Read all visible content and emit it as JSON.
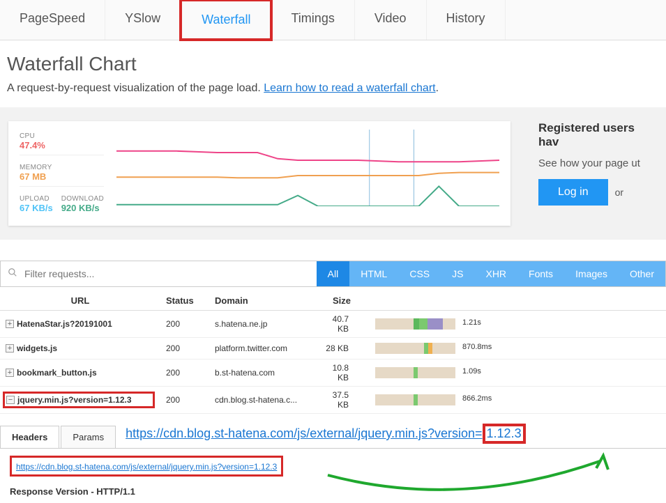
{
  "tabs": [
    "PageSpeed",
    "YSlow",
    "Waterfall",
    "Timings",
    "Video",
    "History"
  ],
  "active_tab": "Waterfall",
  "page_title": "Waterfall Chart",
  "subtitle_prefix": "A request-by-request visualization of the page load. ",
  "subtitle_link": "Learn how to read a waterfall chart",
  "subtitle_suffix": ".",
  "metrics": {
    "cpu_label": "CPU",
    "cpu_value": "47.4%",
    "memory_label": "MEMORY",
    "memory_value": "67 MB",
    "upload_label": "UPLOAD",
    "upload_value": "67 KB/s",
    "download_label": "DOWNLOAD",
    "download_value": "920 KB/s"
  },
  "side": {
    "title": "Registered users hav",
    "text": "See how your page ut",
    "login": "Log in",
    "or": "or"
  },
  "filter": {
    "placeholder": "Filter requests...",
    "tabs": [
      "All",
      "HTML",
      "CSS",
      "JS",
      "XHR",
      "Fonts",
      "Images",
      "Other"
    ],
    "active": "All"
  },
  "columns": {
    "url": "URL",
    "status": "Status",
    "domain": "Domain",
    "size": "Size"
  },
  "rows": [
    {
      "url": "HatenaStar.js?20191001",
      "status": "200",
      "domain": "s.hatena.ne.jp",
      "size": "40.7 KB",
      "time": "1.21s",
      "exp": "+"
    },
    {
      "url": "widgets.js",
      "status": "200",
      "domain": "platform.twitter.com",
      "size": "28 KB",
      "time": "870.8ms",
      "exp": "+"
    },
    {
      "url": "bookmark_button.js",
      "status": "200",
      "domain": "b.st-hatena.com",
      "size": "10.8 KB",
      "time": "1.09s",
      "exp": "+"
    },
    {
      "url": "jquery.min.js?version=1.12.3",
      "status": "200",
      "domain": "cdn.blog.st-hatena.c...",
      "size": "37.5 KB",
      "time": "866.2ms",
      "exp": "−"
    }
  ],
  "detail": {
    "sub_tabs": [
      "Headers",
      "Params"
    ],
    "active_sub_tab": "Headers",
    "big_url_prefix": "https://cdn.blog.st-hatena.com/js/external/jquery.min.js?version=",
    "big_url_version": "1.12.3",
    "small_url": "https://cdn.blog.st-hatena.com/js/external/jquery.min.js?version=1.12.3",
    "response_version": "Response Version - HTTP/1.1"
  },
  "chart_data": {
    "type": "line",
    "series": [
      {
        "name": "CPU",
        "color": "#e48",
        "values": [
          28,
          28,
          28,
          28,
          29,
          30,
          30,
          30,
          38,
          40,
          40,
          40,
          40,
          41,
          42,
          42,
          42,
          42,
          41,
          40
        ]
      },
      {
        "name": "Memory",
        "color": "#f0a050",
        "values": [
          62,
          62,
          62,
          62,
          62,
          62,
          63,
          63,
          63,
          60,
          60,
          60,
          60,
          60,
          60,
          60,
          57,
          56,
          56,
          56
        ]
      },
      {
        "name": "Download",
        "color": "#4a8",
        "values": [
          98,
          98,
          98,
          98,
          98,
          98,
          98,
          98,
          98,
          86,
          100,
          100,
          100,
          100,
          100,
          100,
          74,
          100,
          100,
          100
        ]
      }
    ],
    "height": 110
  }
}
